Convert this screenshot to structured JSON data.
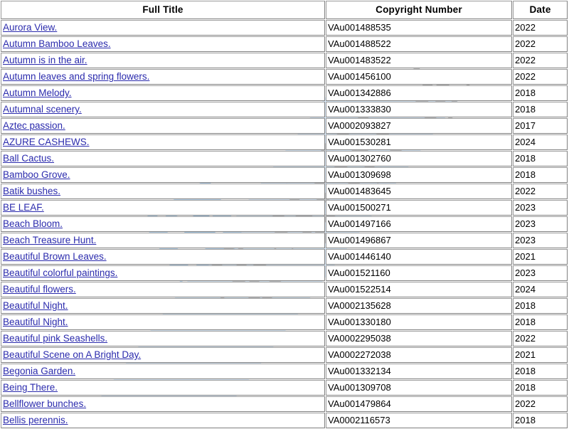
{
  "table": {
    "columns": [
      {
        "key": "title",
        "label": "Full Title"
      },
      {
        "key": "number",
        "label": "Copyright Number"
      },
      {
        "key": "date",
        "label": "Date"
      }
    ],
    "link_color": "#2b2bad",
    "header_text_color": "#000000",
    "border_color": "#808080",
    "rows": [
      {
        "title": "Aurora View.",
        "number": "VAu001488535",
        "date": "2022"
      },
      {
        "title": "Autumn Bamboo Leaves.",
        "number": "VAu001488522",
        "date": "2022"
      },
      {
        "title": "Autumn is in the air.",
        "number": "VAu001483522",
        "date": "2022"
      },
      {
        "title": "Autumn leaves and spring flowers.",
        "number": "VAu001456100",
        "date": "2022"
      },
      {
        "title": "Autumn Melody.",
        "number": "VAu001342886",
        "date": "2018"
      },
      {
        "title": "Autumnal scenery.",
        "number": "VAu001333830",
        "date": "2018"
      },
      {
        "title": "Aztec passion.",
        "number": "VA0002093827",
        "date": "2017"
      },
      {
        "title": "AZURE CASHEWS.",
        "number": "VAu001530281",
        "date": "2024"
      },
      {
        "title": "Ball Cactus.",
        "number": "VAu001302760",
        "date": "2018"
      },
      {
        "title": "Bamboo Grove.",
        "number": "VAu001309698",
        "date": "2018"
      },
      {
        "title": "Batik bushes.",
        "number": "VAu001483645",
        "date": "2022"
      },
      {
        "title": "BE LEAF.",
        "number": "VAu001500271",
        "date": "2023"
      },
      {
        "title": "Beach Bloom.",
        "number": "VAu001497166",
        "date": "2023"
      },
      {
        "title": "Beach Treasure Hunt.",
        "number": "VAu001496867",
        "date": "2023"
      },
      {
        "title": "Beautiful Brown Leaves.",
        "number": "VAu001446140",
        "date": "2021"
      },
      {
        "title": "Beautiful colorful paintings.",
        "number": "VAu001521160",
        "date": "2023"
      },
      {
        "title": "Beautiful flowers.",
        "number": "VAu001522514",
        "date": "2024"
      },
      {
        "title": "Beautiful Night.",
        "number": "VA0002135628",
        "date": "2018"
      },
      {
        "title": "Beautiful Night.",
        "number": "VAu001330180",
        "date": "2018"
      },
      {
        "title": "Beautiful pink Seashells.",
        "number": "VA0002295038",
        "date": "2022"
      },
      {
        "title": "Beautiful Scene on A Bright Day.",
        "number": "VA0002272038",
        "date": "2021"
      },
      {
        "title": "Begonia Garden.",
        "number": "VAu001332134",
        "date": "2018"
      },
      {
        "title": "Being There.",
        "number": "VAu001309708",
        "date": "2018"
      },
      {
        "title": "Bellflower bunches.",
        "number": "VAu001479864",
        "date": "2022"
      },
      {
        "title": "Bellis perennis.",
        "number": "VA0002116573",
        "date": "2018"
      }
    ]
  },
  "watermark": {
    "badge_color": "#cfe4f7",
    "glyph_color": "#bdbdbd",
    "text": "知识产权"
  }
}
